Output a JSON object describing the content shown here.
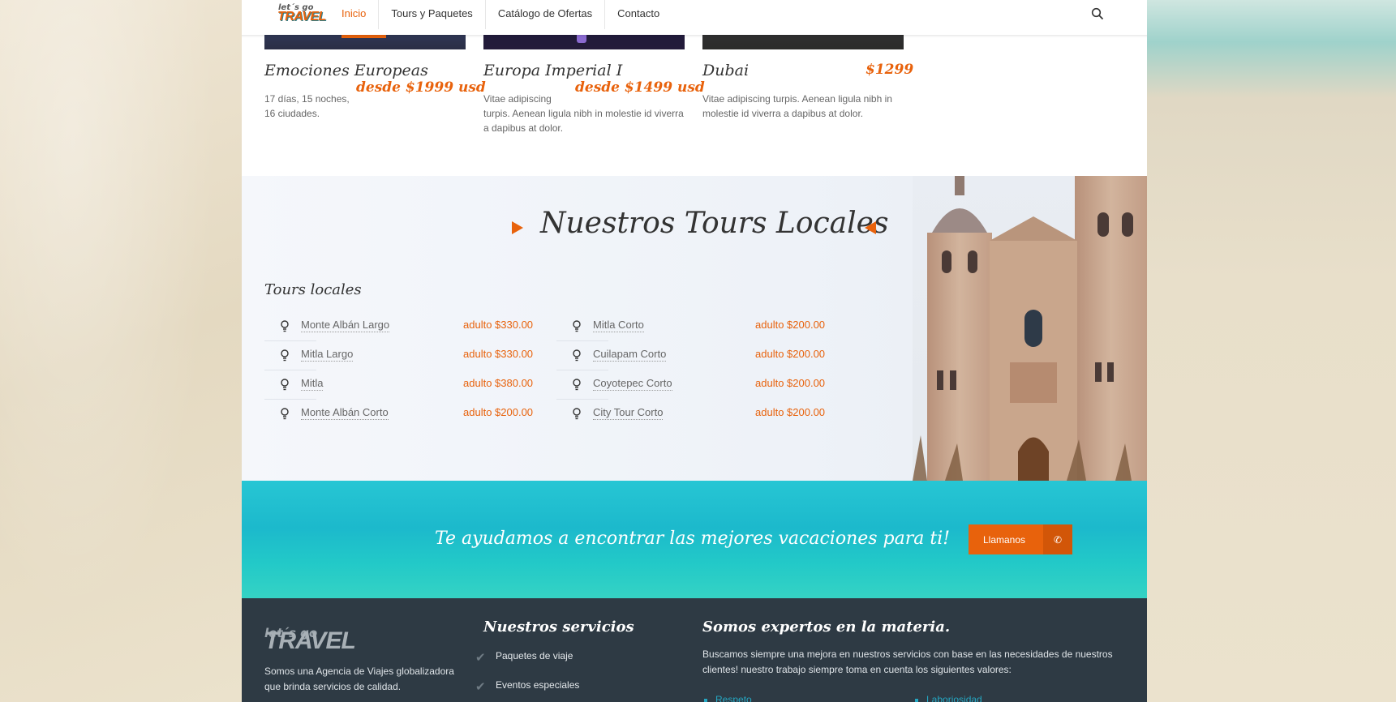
{
  "nav": {
    "logo_top": "let´s go",
    "logo_main": "TRAVEL",
    "items": [
      "Inicio",
      "Tours y Paquetes",
      "Catálogo de Ofertas",
      "Contacto"
    ],
    "search_icon": "search-icon"
  },
  "cards": [
    {
      "title": "Emociones Europeas",
      "price": "desde $1999 usd",
      "text": "17 días, 15 noches,",
      "text2": "16 ciudades."
    },
    {
      "title": "Europa Imperial I",
      "price": "desde $1499 usd",
      "text": "Vitae adipiscing",
      "text2": "turpis. Aenean ligula nibh in molestie id viverra a dapibus at dolor."
    },
    {
      "title": "Dubai",
      "price": "$1299",
      "text": "Vitae adipiscing turpis. Aenean ligula nibh in molestie id viverra a dapibus at dolor."
    }
  ],
  "tours": {
    "title": "Nuestros Tours Locales",
    "subtitle": "Tours locales",
    "left": [
      {
        "name": "Monte Albán Largo",
        "price": "adulto $330.00"
      },
      {
        "name": "Mitla Largo",
        "price": "adulto $330.00"
      },
      {
        "name": "Mitla",
        "price": "adulto $380.00"
      },
      {
        "name": "Monte Albán Corto",
        "price": "adulto $200.00"
      }
    ],
    "right": [
      {
        "name": "Mitla Corto",
        "price": "adulto $200.00"
      },
      {
        "name": "Cuilapam Corto",
        "price": "adulto $200.00"
      },
      {
        "name": "Coyotepec Corto",
        "price": "adulto $200.00"
      },
      {
        "name": "City Tour Corto",
        "price": "adulto $200.00"
      }
    ]
  },
  "banner": {
    "text": "Te ayudamos a encontrar las mejores vacaciones para ti!",
    "button": "Llamanos"
  },
  "footer": {
    "logo_top": "let´s go",
    "logo_main": "TRAVEL",
    "about": "Somos una Agencia de Viajes globalizadora que brinda servicios de calidad.",
    "services_title": "Nuestros servicios",
    "services": [
      "Paquetes de viaje",
      "Eventos especiales"
    ],
    "experts_title": "Somos expertos en la materia.",
    "experts_text": "Buscamos siempre una mejora en nuestros servicios con base en las necesidades de nuestros clientes! nuestro trabajo siempre toma en cuenta los siguientes valores:",
    "values": [
      "Respeto",
      "Laboriosidad"
    ]
  },
  "colors": {
    "accent": "#e8620c",
    "footer_bg": "#2e3a44",
    "teal": "#1cb9cc"
  }
}
